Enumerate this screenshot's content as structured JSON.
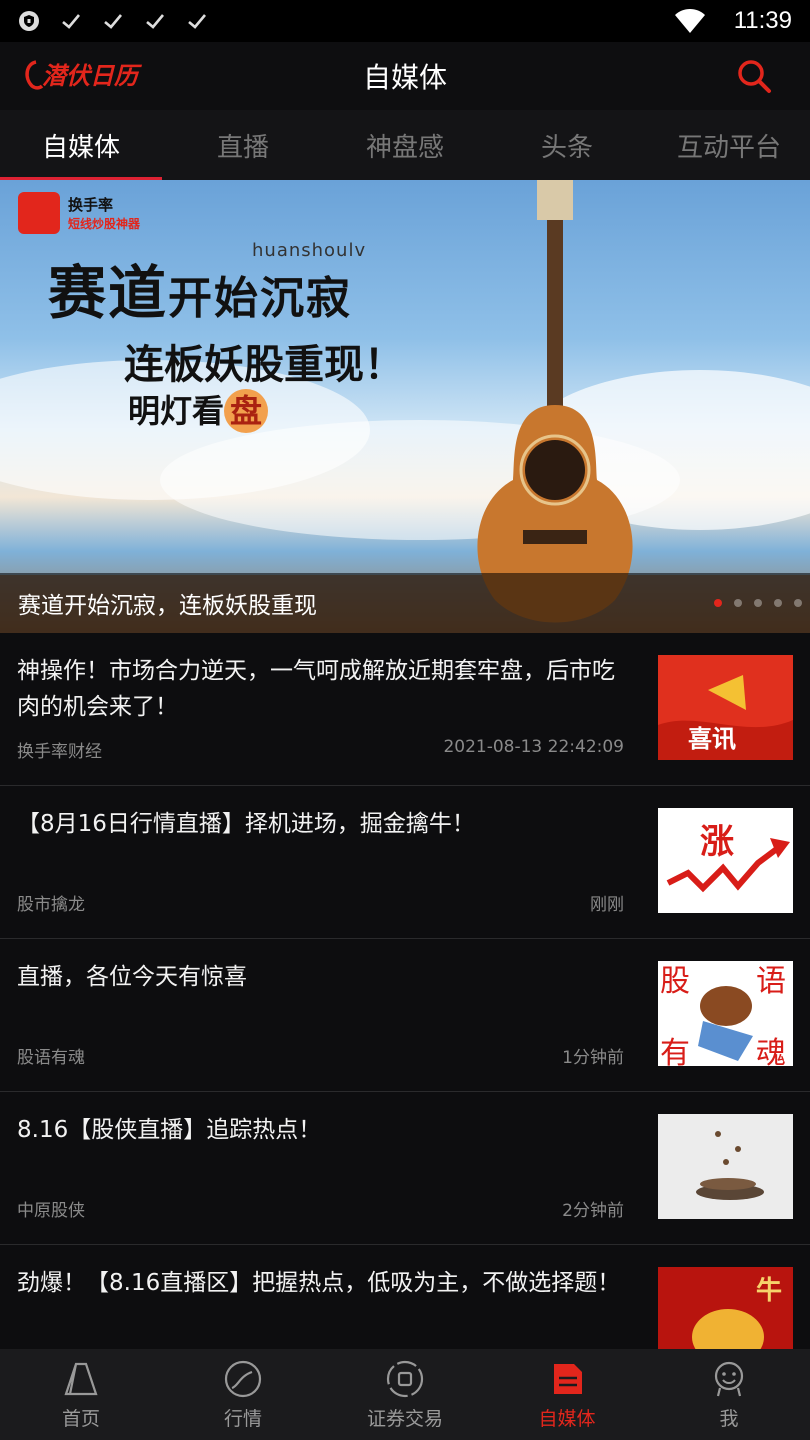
{
  "status_bar": {
    "time": "11:39",
    "icons": [
      "vpn-shield-icon",
      "check-icon",
      "check-icon",
      "check-icon",
      "check-icon",
      "wifi-icon",
      "battery-icon"
    ]
  },
  "header": {
    "logo_text": "潜伏日历",
    "title": "自媒体",
    "search_icon": "search-icon"
  },
  "tabs": [
    {
      "label": "自媒体",
      "active": true
    },
    {
      "label": "直播",
      "active": false
    },
    {
      "label": "神盘感",
      "active": false
    },
    {
      "label": "头条",
      "active": false
    },
    {
      "label": "互动平台",
      "active": false
    }
  ],
  "banner": {
    "brand_name": "换手率",
    "brand_slogan": "短线炒股神器",
    "pinyin": "huanshoulv",
    "headline_big": "赛道",
    "headline_small": "开始沉寂",
    "line2": "连板妖股重现！",
    "line3": "明灯看",
    "line3_badge": "盘",
    "caption": "赛道开始沉寂，连板妖股重现",
    "dots": 5,
    "active_dot": 0
  },
  "feed": [
    {
      "title": "神操作！市场合力逆天，一气呵成解放近期套牢盘，后市吃肉的机会来了！",
      "source": "换手率财经",
      "time": "2021-08-13 22:42:09",
      "thumb": "xixun-announcement",
      "thumb_text": "喜讯"
    },
    {
      "title": "【8月16日行情直播】择机进场，掘金擒牛！",
      "source": "股市擒龙",
      "time": "刚刚",
      "thumb": "rising-chart",
      "thumb_text": "涨"
    },
    {
      "title": "直播，各位今天有惊喜",
      "source": "股语有魂",
      "time": "1分钟前",
      "thumb": "bull-logo",
      "thumb_text": [
        "股",
        "语",
        "有",
        "魂"
      ]
    },
    {
      "title": "8.16【股侠直播】追踪热点！",
      "source": "中原股侠",
      "time": "2分钟前",
      "thumb": "falling-coins",
      "thumb_text": ""
    },
    {
      "title": " 劲爆！【8.16直播区】把握热点，低吸为主，不做选择题！",
      "source": "",
      "time": "",
      "thumb": "golden-bull",
      "thumb_text": "牛"
    }
  ],
  "bottom_nav": [
    {
      "label": "首页",
      "icon": "home-icon",
      "active": false
    },
    {
      "label": "行情",
      "icon": "market-icon",
      "active": false
    },
    {
      "label": "证券交易",
      "icon": "trade-icon",
      "active": false
    },
    {
      "label": "自媒体",
      "icon": "media-icon",
      "active": true
    },
    {
      "label": "我",
      "icon": "profile-icon",
      "active": false
    }
  ],
  "colors": {
    "accent": "#e2261c",
    "background": "#0d0d0f",
    "tab_inactive": "#777777"
  }
}
